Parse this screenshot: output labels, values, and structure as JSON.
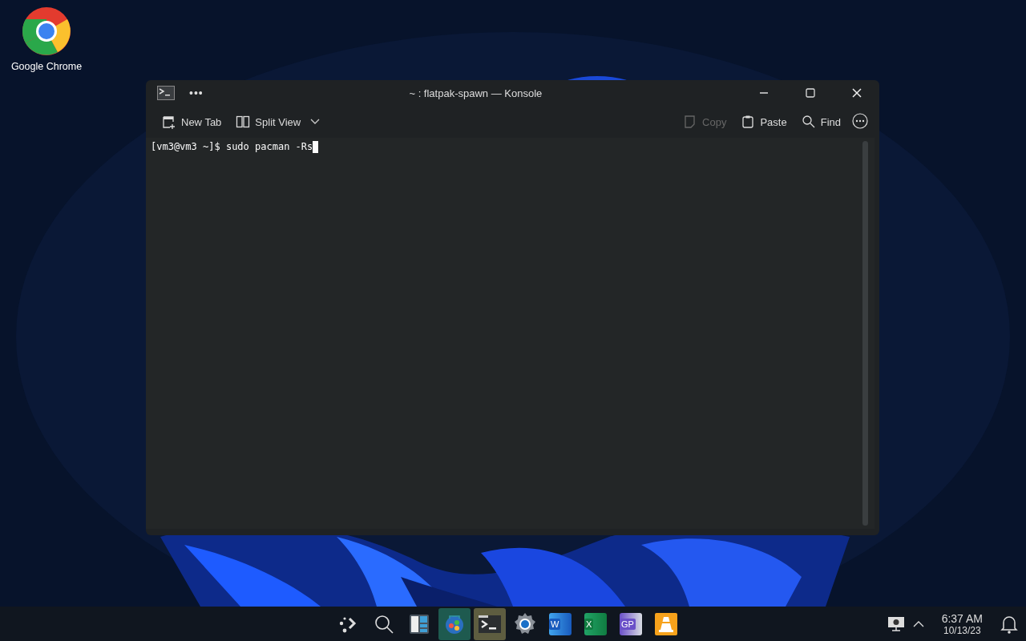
{
  "desktop_icons": [
    {
      "label": "Google Chrome",
      "kind": "chrome"
    }
  ],
  "window": {
    "title": "~ : flatpak-spawn — Konsole",
    "menu_glyph": "•••",
    "toolbar_left": [
      {
        "label": "New Tab",
        "kind": "newtab",
        "disabled": false
      },
      {
        "label": "Split View",
        "kind": "split",
        "disabled": false
      }
    ],
    "toolbar_right": [
      {
        "label": "Copy",
        "kind": "copy",
        "disabled": true
      },
      {
        "label": "Paste",
        "kind": "paste",
        "disabled": false
      },
      {
        "label": "Find",
        "kind": "find",
        "disabled": false
      }
    ],
    "terminal": {
      "prompt": "[vm3@vm3 ~]$ sudo pacman -Rs"
    }
  },
  "taskbar": {
    "apps": [
      {
        "kind": "launcher",
        "active": false
      },
      {
        "kind": "search",
        "active": false
      },
      {
        "kind": "widgets",
        "active": false
      },
      {
        "kind": "store",
        "active": true
      },
      {
        "kind": "terminal",
        "active": true
      },
      {
        "kind": "settings",
        "active": false
      },
      {
        "kind": "word",
        "glyph": "W",
        "active": false
      },
      {
        "kind": "excel",
        "glyph": "X",
        "active": false
      },
      {
        "kind": "gp",
        "glyph": "GP",
        "active": false
      },
      {
        "kind": "vlc",
        "active": false
      }
    ],
    "time": "6:37 AM",
    "date": "10/13/23"
  }
}
